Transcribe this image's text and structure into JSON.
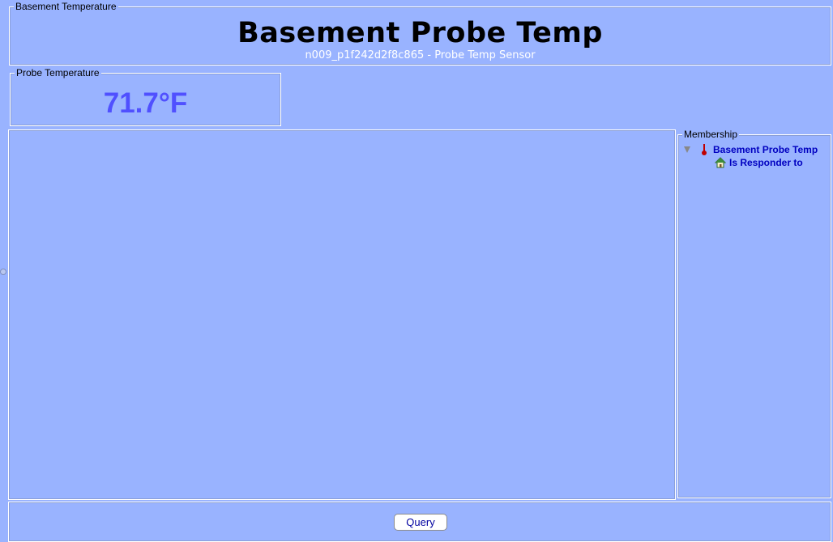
{
  "header": {
    "group_label": "Basement Temperature",
    "title": "Basement Probe Temp",
    "subtitle": "n009_p1f242d2f8c865 - Probe Temp Sensor"
  },
  "probe": {
    "group_label": "Probe Temperature",
    "value": "71.7°F",
    "value_color": "#5050ff"
  },
  "membership": {
    "group_label": "Membership",
    "items": [
      {
        "label": "Basement Probe Temp",
        "icon": "thermometer-icon",
        "expanded": true
      },
      {
        "label": "Is Responder to",
        "icon": "home-icon"
      }
    ]
  },
  "footer": {
    "query_label": "Query"
  },
  "colors": {
    "background": "#99b3ff",
    "tree_text": "#0000c0",
    "subtitle": "#ffffff"
  }
}
